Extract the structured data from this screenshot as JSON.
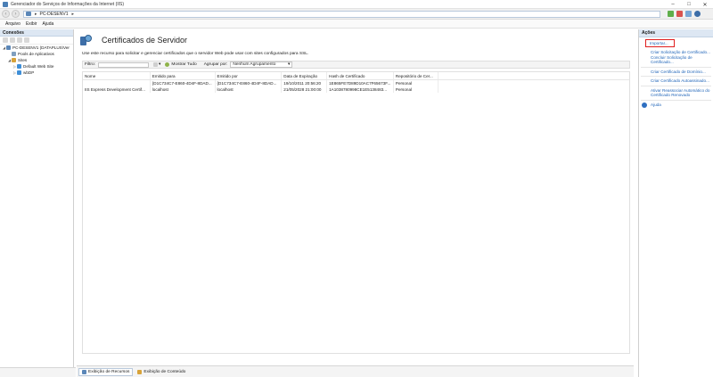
{
  "window": {
    "title": "Gerenciador do Serviços de Informações da Internet (IIS)"
  },
  "address": {
    "crumb": "PC-DESENV1",
    "separator": "▸"
  },
  "menu": [
    "Arquivo",
    "Exibir",
    "Ajuda"
  ],
  "connections": {
    "title": "Conexões",
    "tree": [
      {
        "label": "PC-DESENV1 (DATAPLUS\\Ver",
        "level": 0,
        "expander": "◢",
        "icon_color": "#5b87b8"
      },
      {
        "label": "Pools de Aplicativos",
        "level": 1,
        "expander": "",
        "icon_color": "#7f9fbf"
      },
      {
        "label": "Sites",
        "level": 1,
        "expander": "◢",
        "icon_color": "#d8a33a"
      },
      {
        "label": "Default Web Site",
        "level": 2,
        "expander": "▷",
        "icon_color": "#3f8fd8"
      },
      {
        "label": "wbDP",
        "level": 2,
        "expander": "▷",
        "icon_color": "#3f8fd8"
      }
    ]
  },
  "main": {
    "title": "Certificados de Servidor",
    "description": "Use este recurso para solicitar e gerenciar certificados que o servidor Web pode usar com sites configurados para SSL.",
    "filter": {
      "label": "Filtro:",
      "go": "▾",
      "show_all": "Mostrar Tudo",
      "group_by_label": "Agrupar por:",
      "group_value": "Nenhum Agrupamento",
      "group_arrow": "▾"
    },
    "table": {
      "headers": [
        "Nome",
        "Emitido para",
        "Emitido por",
        "Data de Expiração",
        "Hash de Certificado",
        "Repositório de Cer..."
      ],
      "rows": [
        [
          "",
          "{D1C734C7-E860-4D4F-8DAD...",
          "{D1C734C7-E860-4D4F-8DAD...",
          "19/10/2011 20:56:20",
          "1E865FE7D89D10AC7F65673F...",
          "Personal"
        ],
        [
          "IIS Express Development Certif...",
          "localhost",
          "localhost",
          "21/05/2028 21:00:00",
          "1A1038780998CE1E5138483...",
          "Personal"
        ]
      ]
    }
  },
  "bottom_tabs": [
    {
      "label": "Exibição de Recursos",
      "active": true
    },
    {
      "label": "Exibição de Conteúdo",
      "active": false
    }
  ],
  "actions": {
    "title": "Ações",
    "import": "Importar...",
    "items": [
      "Criar Solicitação de Certificado...",
      "Concluir Solicitação de Certificado...",
      "Criar Certificado de Domínio...",
      "Criar Certificado Autoassinado...",
      "Ativar Reassociar Automático do Certificado Renovado"
    ],
    "help": "Ajuda"
  }
}
